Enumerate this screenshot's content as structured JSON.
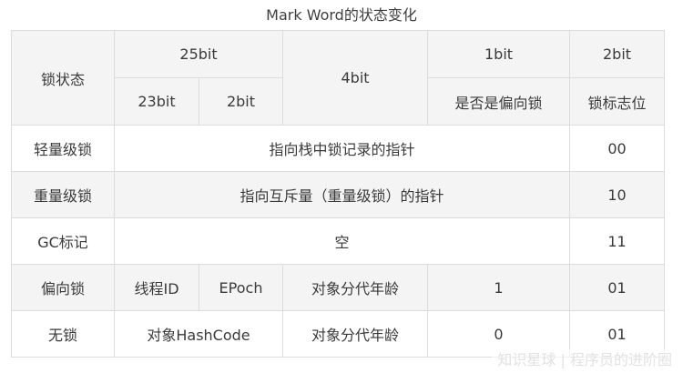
{
  "caption": "Mark Word的状态变化",
  "header": {
    "lock_state": "锁状态",
    "bits_25": "25bit",
    "bits_4": "4bit",
    "bits_1": "1bit",
    "bits_2": "2bit",
    "sub_23bit": "23bit",
    "sub_2bit": "2bit",
    "biased_flag": "是否是偏向锁",
    "lock_flag_bits": "锁标志位"
  },
  "rows": [
    {
      "state": "轻量级锁",
      "content": "指向栈中锁记录的指针",
      "flag": "00"
    },
    {
      "state": "重量级锁",
      "content": "指向互斥量（重量级锁）的指针",
      "flag": "10"
    },
    {
      "state": "GC标记",
      "content": "空",
      "flag": "11"
    },
    {
      "state": "偏向锁",
      "thread_id": "线程ID",
      "epoch": "EPoch",
      "age": "对象分代年龄",
      "biased": "1",
      "flag": "01"
    },
    {
      "state": "无锁",
      "hashcode": "对象HashCode",
      "age": "对象分代年龄",
      "biased": "0",
      "flag": "01"
    }
  ],
  "watermark": "知识星球 | 程序员的进阶圈"
}
